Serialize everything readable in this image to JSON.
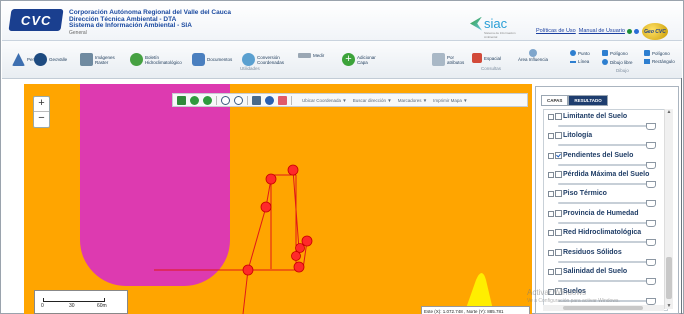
{
  "header": {
    "logo_text": "CVC",
    "org_line1": "Corporación Autónoma Regional del Valle del Cauca",
    "org_line2": "Dirección Técnica Ambiental - DTA",
    "org_line3": "Sistema de Información Ambiental - SIA",
    "org_sub": "General",
    "siac_text": "siac",
    "siac_small": "Sistema de Información Ambiental",
    "link_policies": "Políticas de Uso",
    "link_manual": "Manual de Usuario",
    "geocvc_text": "Geo CVC"
  },
  "ribbon": {
    "perfil": "Perfil",
    "geovalle": "GeoValle",
    "imagenes_raster": "Imágenes Raster",
    "boletin": "Boletín Hidroclimatológico",
    "documentos": "Documentos",
    "conversion": "Conversión Coordenadas",
    "medir": "Medir",
    "adicionar_capa": "Adicionar Capa",
    "group_utilidades": "Utilidades",
    "por_atributos": "Por atributos",
    "espacial": "Espacial",
    "group_consultas": "Consultas",
    "area_influencia": "Área Influencia",
    "punto": "Punto",
    "poligono": "Polígono",
    "poligono2": "Polígono",
    "linea": "Línea",
    "dibujo_libre": "Dibujo libre",
    "rectangulo": "Rectángulo",
    "group_dibujo": "Dibujo"
  },
  "map": {
    "zoom_in": "+",
    "zoom_out": "−",
    "tool_ubicar": "Ubicar Coordenada ▼",
    "tool_buscar": "Buscar dirección ▼",
    "tool_marcadores": "Marcadores ▼",
    "tool_imprimir": "Imprimir Mapa ▼",
    "scale_0": "0",
    "scale_30": "30",
    "scale_60": "60m",
    "coords": "Este (X): 1.072.748 , Norte (Y): 885.781",
    "colors": {
      "background": "#ffa500",
      "polygon": "#dd3ab0",
      "points": "#ff2020",
      "highlight": "#ffee00"
    }
  },
  "panel": {
    "tab_capas": "CAPAS",
    "tab_resultado": "RESULTADO",
    "layers": [
      {
        "name": "Limitante del Suelo",
        "checked": false
      },
      {
        "name": "Litología",
        "checked": false
      },
      {
        "name": "Pendientes del Suelo",
        "checked": true
      },
      {
        "name": "Pérdida Máxima del Suelo",
        "checked": false
      },
      {
        "name": "Piso Térmico",
        "checked": false
      },
      {
        "name": "Provincia de Humedad",
        "checked": false
      },
      {
        "name": "Red Hidroclimatológica",
        "checked": false
      },
      {
        "name": "Residuos Sólidos",
        "checked": false
      },
      {
        "name": "Salinidad del Suelo",
        "checked": false
      },
      {
        "name": "Suelos",
        "checked": false
      }
    ]
  },
  "watermark": {
    "line1": "Activar Windows",
    "line2": "Ve a Configuración para activar Windows."
  }
}
